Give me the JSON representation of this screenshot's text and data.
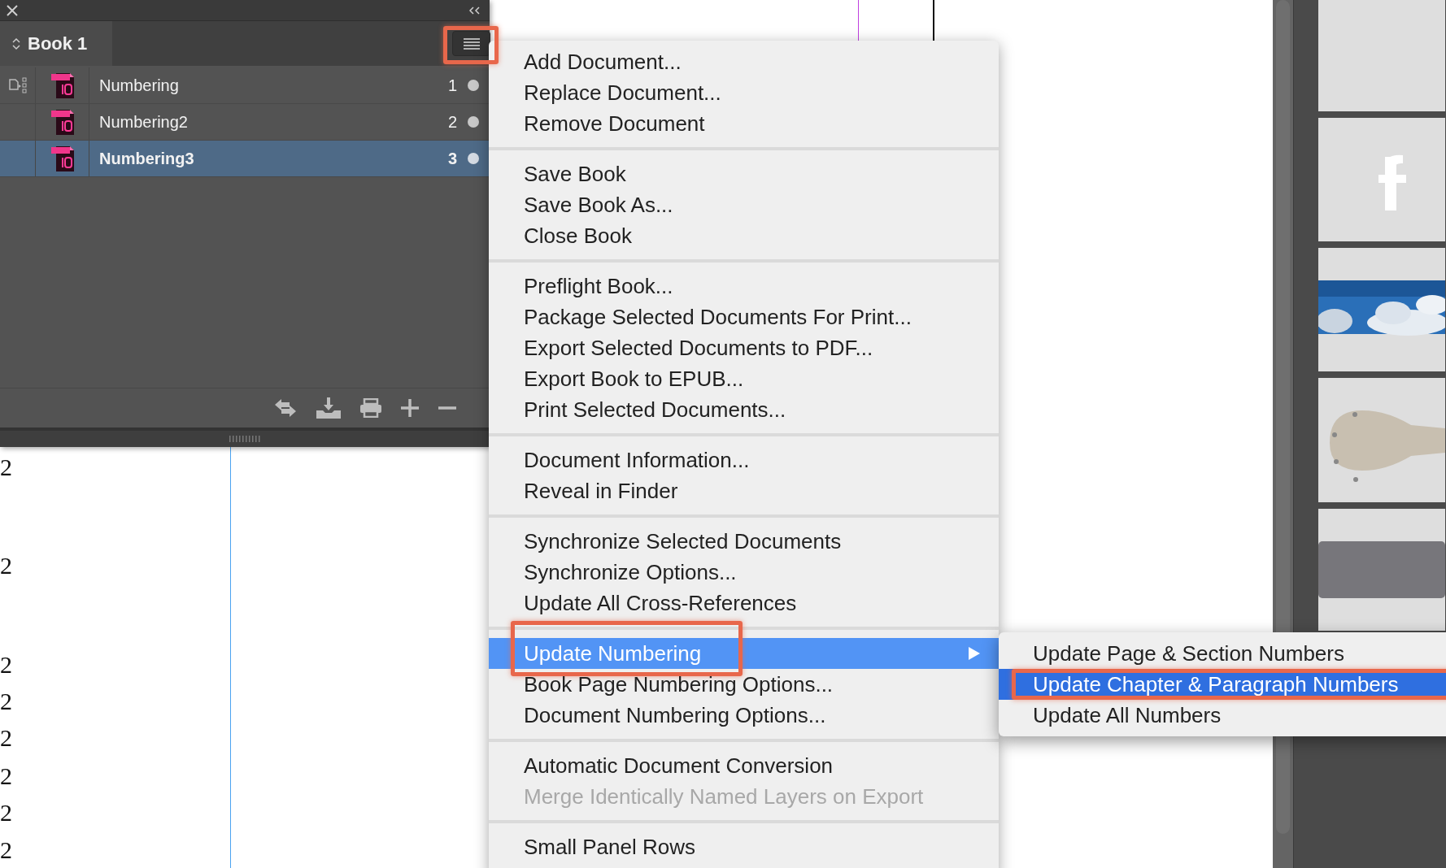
{
  "panel": {
    "tab": "Book 1",
    "menu_button_callout": true,
    "documents": [
      {
        "name": "Numbering",
        "pages": "1",
        "selected": false,
        "style_source": true
      },
      {
        "name": "Numbering2",
        "pages": "2",
        "selected": false,
        "style_source": false
      },
      {
        "name": "Numbering3",
        "pages": "3",
        "selected": true,
        "style_source": false
      }
    ]
  },
  "page_numbers": [
    "2",
    "2",
    "2",
    "2",
    "2",
    "2",
    "2",
    "2"
  ],
  "menu": {
    "groups": [
      [
        {
          "label": "Add Document...",
          "selected": false,
          "disabled": false,
          "has_submenu": false,
          "callout": false
        },
        {
          "label": "Replace Document...",
          "selected": false,
          "disabled": false,
          "has_submenu": false,
          "callout": false
        },
        {
          "label": "Remove Document",
          "selected": false,
          "disabled": false,
          "has_submenu": false,
          "callout": false
        }
      ],
      [
        {
          "label": "Save Book",
          "selected": false,
          "disabled": false,
          "has_submenu": false,
          "callout": false
        },
        {
          "label": "Save Book As...",
          "selected": false,
          "disabled": false,
          "has_submenu": false,
          "callout": false
        },
        {
          "label": "Close Book",
          "selected": false,
          "disabled": false,
          "has_submenu": false,
          "callout": false
        }
      ],
      [
        {
          "label": "Preflight Book...",
          "selected": false,
          "disabled": false,
          "has_submenu": false,
          "callout": false
        },
        {
          "label": "Package Selected Documents For Print...",
          "selected": false,
          "disabled": false,
          "has_submenu": false,
          "callout": false
        },
        {
          "label": "Export Selected Documents to PDF...",
          "selected": false,
          "disabled": false,
          "has_submenu": false,
          "callout": false
        },
        {
          "label": "Export Book to EPUB...",
          "selected": false,
          "disabled": false,
          "has_submenu": false,
          "callout": false
        },
        {
          "label": "Print Selected Documents...",
          "selected": false,
          "disabled": false,
          "has_submenu": false,
          "callout": false
        }
      ],
      [
        {
          "label": "Document Information...",
          "selected": false,
          "disabled": false,
          "has_submenu": false,
          "callout": false
        },
        {
          "label": "Reveal in Finder",
          "selected": false,
          "disabled": false,
          "has_submenu": false,
          "callout": false
        }
      ],
      [
        {
          "label": "Synchronize Selected Documents",
          "selected": false,
          "disabled": false,
          "has_submenu": false,
          "callout": false
        },
        {
          "label": "Synchronize Options...",
          "selected": false,
          "disabled": false,
          "has_submenu": false,
          "callout": false
        },
        {
          "label": "Update All Cross-References",
          "selected": false,
          "disabled": false,
          "has_submenu": false,
          "callout": false
        }
      ],
      [
        {
          "label": "Update Numbering",
          "selected": true,
          "disabled": false,
          "has_submenu": true,
          "callout": true
        },
        {
          "label": "Book Page Numbering Options...",
          "selected": false,
          "disabled": false,
          "has_submenu": false,
          "callout": false
        },
        {
          "label": "Document Numbering Options...",
          "selected": false,
          "disabled": false,
          "has_submenu": false,
          "callout": false
        }
      ],
      [
        {
          "label": "Automatic Document Conversion",
          "selected": false,
          "disabled": false,
          "has_submenu": false,
          "callout": false
        },
        {
          "label": "Merge Identically Named Layers on Export",
          "selected": false,
          "disabled": true,
          "has_submenu": false,
          "callout": false
        }
      ],
      [
        {
          "label": "Small Panel Rows",
          "selected": false,
          "disabled": false,
          "has_submenu": false,
          "callout": false
        }
      ]
    ]
  },
  "submenu": {
    "items": [
      {
        "label": "Update Page & Section Numbers",
        "selected": false,
        "callout": false
      },
      {
        "label": "Update Chapter & Paragraph Numbers",
        "selected": true,
        "callout": true
      },
      {
        "label": "Update All Numbers",
        "selected": false,
        "callout": false
      }
    ]
  }
}
